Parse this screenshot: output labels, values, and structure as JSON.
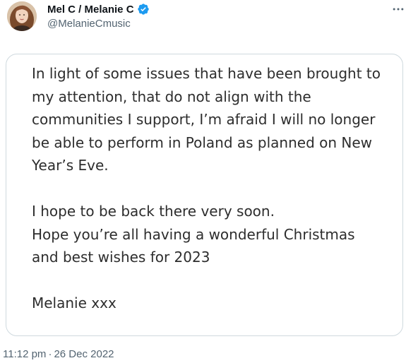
{
  "tweet": {
    "display_name": "Mel C / Melanie C",
    "handle": "@MelanieCmusic",
    "verified_icon": "verified-badge-icon",
    "more_icon": "more-horizontal-icon",
    "more_label": "···",
    "accent_color": "#1d9bf0",
    "media": {
      "paragraph1": [
        "In light of some issues that have been brought to",
        "my attention, that do not align with the",
        "communities I support, I’m afraid I will no longer",
        "be able to perform in Poland as planned on New",
        "Year’s Eve."
      ],
      "paragraph2": [
        "I hope to be back there very soon.",
        "Hope you’re all having a wonderful Christmas",
        "and best wishes for 2023"
      ],
      "signoff": "Melanie xxx"
    },
    "time": "11:12 pm",
    "separator": "·",
    "date": "26 Dec 2022"
  }
}
